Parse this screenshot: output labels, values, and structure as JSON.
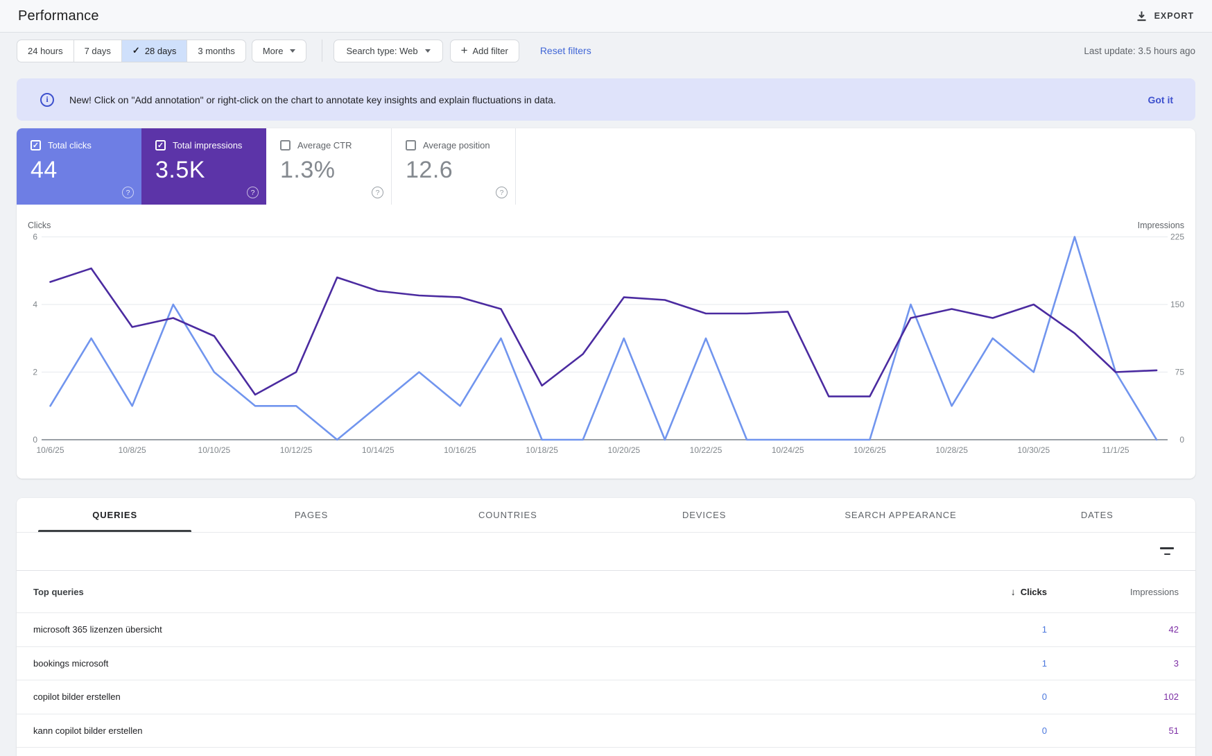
{
  "header": {
    "title": "Performance",
    "export_label": "EXPORT"
  },
  "filters": {
    "date_ranges": [
      {
        "label": "24 hours",
        "selected": false
      },
      {
        "label": "7 days",
        "selected": false
      },
      {
        "label": "28 days",
        "selected": true
      },
      {
        "label": "3 months",
        "selected": false
      }
    ],
    "more_label": "More",
    "search_type_label": "Search type: Web",
    "add_filter_label": "Add filter",
    "reset_label": "Reset filters",
    "last_update": "Last update: 3.5 hours ago"
  },
  "banner": {
    "message": "New! Click on \"Add annotation\" or right-click on the chart to annotate key insights and explain fluctuations in data.",
    "action": "Got it"
  },
  "metrics": [
    {
      "label": "Total clicks",
      "value": "44",
      "checked": true,
      "bg": "#6e7ee4",
      "value_color": "#ffffff"
    },
    {
      "label": "Total impressions",
      "value": "3.5K",
      "checked": true,
      "bg": "#5c34a8",
      "value_color": "#ffffff"
    },
    {
      "label": "Average CTR",
      "value": "1.3%",
      "checked": false,
      "bg": "#ffffff",
      "value_color": "#84898f"
    },
    {
      "label": "Average position",
      "value": "12.6",
      "checked": false,
      "bg": "#ffffff",
      "value_color": "#84898f"
    }
  ],
  "chart_data": {
    "type": "line",
    "x": [
      "10/6/25",
      "10/7/25",
      "10/8/25",
      "10/9/25",
      "10/10/25",
      "10/11/25",
      "10/12/25",
      "10/13/25",
      "10/14/25",
      "10/15/25",
      "10/16/25",
      "10/17/25",
      "10/18/25",
      "10/19/25",
      "10/20/25",
      "10/21/25",
      "10/22/25",
      "10/23/25",
      "10/24/25",
      "10/25/25",
      "10/26/25",
      "10/27/25",
      "10/28/25",
      "10/29/25",
      "10/30/25",
      "10/31/25",
      "11/1/25",
      "11/2/25"
    ],
    "x_tick_every": 2,
    "series": [
      {
        "name": "Clicks",
        "axis": "left",
        "color": "#7195ee",
        "values": [
          1,
          3,
          1,
          4,
          2,
          1,
          1,
          0,
          1,
          2,
          1,
          3,
          0,
          0,
          3,
          0,
          3,
          0,
          0,
          0,
          0,
          4,
          1,
          3,
          2,
          6,
          2,
          0
        ]
      },
      {
        "name": "Impressions",
        "axis": "right",
        "color": "#4b2ba0",
        "values": [
          175,
          190,
          125,
          135,
          115,
          50,
          75,
          180,
          165,
          160,
          158,
          145,
          60,
          95,
          158,
          155,
          140,
          140,
          142,
          48,
          48,
          135,
          145,
          135,
          150,
          118,
          75,
          77
        ]
      }
    ],
    "left_axis": {
      "label": "Clicks",
      "ticks": [
        0,
        2,
        4,
        6
      ],
      "max": 6
    },
    "right_axis": {
      "label": "Impressions",
      "ticks": [
        0,
        75,
        150,
        225
      ],
      "max": 225
    },
    "grid": true,
    "legend": "none"
  },
  "table": {
    "tabs": [
      {
        "label": "QUERIES",
        "active": true
      },
      {
        "label": "PAGES",
        "active": false
      },
      {
        "label": "COUNTRIES",
        "active": false
      },
      {
        "label": "DEVICES",
        "active": false
      },
      {
        "label": "SEARCH APPEARANCE",
        "active": false
      },
      {
        "label": "DATES",
        "active": false
      }
    ],
    "columns": {
      "name": "Top queries",
      "clicks": "Clicks",
      "impressions": "Impressions",
      "sorted_by": "clicks-desc"
    },
    "rows": [
      {
        "query": "microsoft 365 lizenzen übersicht",
        "clicks": "1",
        "impressions": "42"
      },
      {
        "query": "bookings microsoft",
        "clicks": "1",
        "impressions": "3"
      },
      {
        "query": "copilot bilder erstellen",
        "clicks": "0",
        "impressions": "102"
      },
      {
        "query": "kann copilot bilder erstellen",
        "clicks": "0",
        "impressions": "51"
      }
    ]
  },
  "colors": {
    "clicks_accent": "#6e7ee4",
    "impressions_accent": "#5c34a8",
    "clicks_line": "#7195ee",
    "impressions_line": "#4b2ba0",
    "clicks_table_value": "#4a77dd",
    "impressions_table_value": "#7d2ea5",
    "link_blue": "#4066d6",
    "banner_bg": "#dfe3fa",
    "banner_link": "#3e51ce"
  }
}
